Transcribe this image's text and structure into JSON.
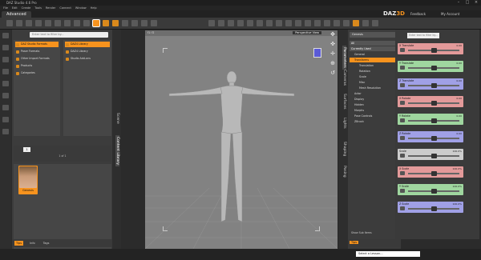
{
  "window": {
    "title": "DAZ Studio 4.6 Pro"
  },
  "menu": [
    "File",
    "Edit",
    "Create",
    "Tools",
    "Render",
    "Connect",
    "Window",
    "Help"
  ],
  "tabs": {
    "active": "Advanced"
  },
  "brand": {
    "left": "DAZ",
    "right": "3D"
  },
  "links": {
    "feedback": "Feedback",
    "account": "My Account"
  },
  "colors": {
    "accent": "#f7931e",
    "red": "#e39a9a",
    "green": "#9fd69f",
    "blue": "#a0a0e6"
  },
  "content_library": {
    "search_placeholder": "Enter text to filter by...",
    "tree_a": [
      "DAZ Studio Formats",
      "Poser Formats",
      "Other Import Formats",
      "Products",
      "Categories"
    ],
    "tree_b": [
      "DAZ4 Library",
      "DAZ4 Library",
      "Studio Add-ons"
    ],
    "page_num": "1",
    "page_text": "1 of 1",
    "thumb_label": "Genesis",
    "bottom_tabs": [
      "Tips",
      "Info",
      "Tags"
    ]
  },
  "left_sidetabs": [
    "Content Library",
    "Scene"
  ],
  "viewport": {
    "label": "f1: f2",
    "camera": "Perspective View"
  },
  "right_sidetabs": [
    "Parameters",
    "Cameras",
    "Surfaces",
    "Lights",
    "Shaping",
    "Posing"
  ],
  "parameters": {
    "node": "Genesis",
    "items": [
      {
        "label": "All",
        "type": "hdr"
      },
      {
        "label": "Currently Used",
        "type": "hdr"
      },
      {
        "label": "General",
        "type": "item"
      },
      {
        "label": "Transforms",
        "type": "sel"
      },
      {
        "label": "Translation",
        "type": "sub"
      },
      {
        "label": "Rotation",
        "type": "sub"
      },
      {
        "label": "Scale",
        "type": "sub"
      },
      {
        "label": "Misc",
        "type": "sub"
      },
      {
        "label": "Mesh Resolution",
        "type": "sub"
      },
      {
        "label": "Actor",
        "type": "item"
      },
      {
        "label": "Display",
        "type": "item"
      },
      {
        "label": "Hidden",
        "type": "item"
      },
      {
        "label": "Morphs",
        "type": "item"
      },
      {
        "label": "Pose Controls",
        "type": "item"
      },
      {
        "label": "ZBrush",
        "type": "item"
      }
    ],
    "show_sub": "Show Sub Items",
    "bottom_tab": "Tips"
  },
  "sliders": {
    "search_placeholder": "Enter text to filter by...",
    "items": [
      {
        "label": "X Translate",
        "value": "0.00",
        "color": "red",
        "pos": 0.5
      },
      {
        "label": "Y Translate",
        "value": "0.00",
        "color": "green",
        "pos": 0.5
      },
      {
        "label": "Z Translate",
        "value": "0.00",
        "color": "blue",
        "pos": 0.5
      },
      {
        "label": "X Rotate",
        "value": "0.00",
        "color": "red",
        "pos": 0.5
      },
      {
        "label": "Y Rotate",
        "value": "0.00",
        "color": "green",
        "pos": 0.5
      },
      {
        "label": "Z Rotate",
        "value": "0.00",
        "color": "blue",
        "pos": 0.5
      },
      {
        "label": "Scale",
        "value": "100.0%",
        "color": "grey",
        "pos": 0.5
      },
      {
        "label": "X Scale",
        "value": "100.0%",
        "color": "red",
        "pos": 0.5
      },
      {
        "label": "Y Scale",
        "value": "100.0%",
        "color": "green",
        "pos": 0.5
      },
      {
        "label": "Z Scale",
        "value": "100.0%",
        "color": "blue",
        "pos": 0.5
      }
    ]
  },
  "status": {
    "lesson": "Select a Lesson..."
  }
}
